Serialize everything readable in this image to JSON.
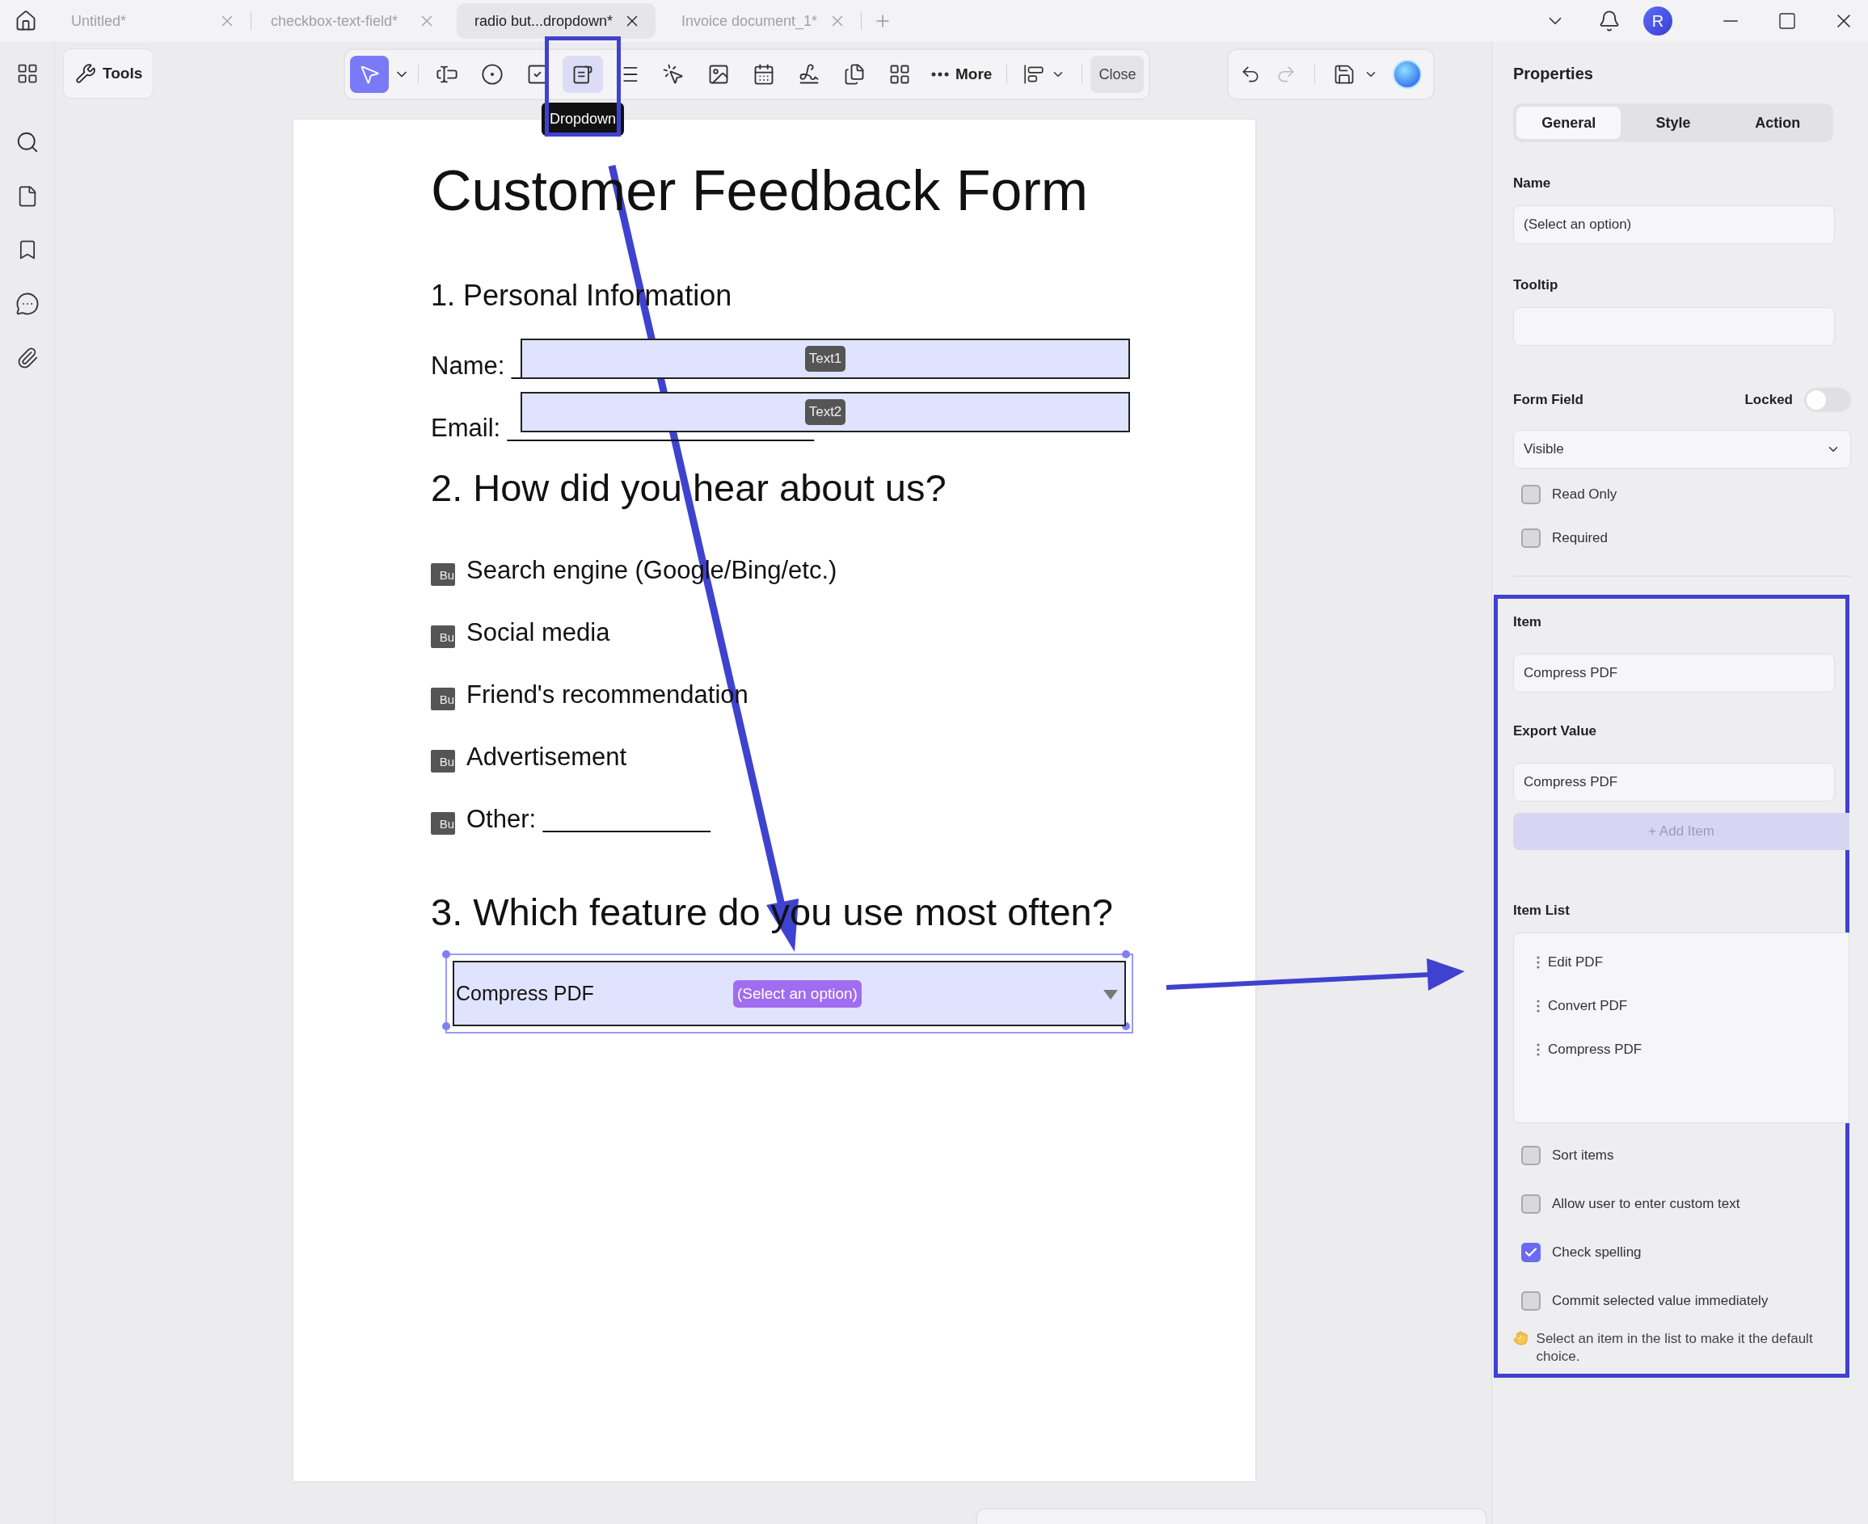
{
  "tabs": [
    {
      "label": "Untitled*",
      "selected": false
    },
    {
      "label": "checkbox-text-field*",
      "selected": false
    },
    {
      "label": "radio but...dropdown*",
      "selected": true
    },
    {
      "label": "Invoice document_1*",
      "selected": false
    }
  ],
  "avatar": {
    "initial": "R"
  },
  "toolbar": {
    "tools_button": "Tools",
    "tools": [
      {
        "kind": "select",
        "selected": true,
        "hovered": false
      },
      {
        "kind": "text-field",
        "selected": false,
        "hovered": false
      },
      {
        "kind": "radio",
        "selected": false,
        "hovered": false
      },
      {
        "kind": "checkbox",
        "selected": false,
        "hovered": false
      },
      {
        "kind": "dropdown",
        "selected": false,
        "hovered": true
      },
      {
        "kind": "list-box",
        "selected": false,
        "hovered": false
      },
      {
        "kind": "button",
        "selected": false,
        "hovered": false
      },
      {
        "kind": "image",
        "selected": false,
        "hovered": false
      },
      {
        "kind": "date",
        "selected": false,
        "hovered": false
      },
      {
        "kind": "signature",
        "selected": false,
        "hovered": false
      },
      {
        "kind": "copy",
        "selected": false,
        "hovered": false
      },
      {
        "kind": "grid",
        "selected": false,
        "hovered": false
      }
    ],
    "tooltip": "Dropdown",
    "more": "More",
    "close": "Close"
  },
  "document": {
    "title": "Customer Feedback Form",
    "section_1": {
      "heading": "1. Personal Information",
      "fields": [
        {
          "label": "Name: _",
          "tag": "Text1"
        },
        {
          "label": "Email: ______________________",
          "tag": "Text2"
        }
      ]
    },
    "section_2": {
      "heading": "2. How did you hear about us?",
      "options": [
        {
          "label": "Search engine (Google/Bing/etc.)",
          "badge": "Bu"
        },
        {
          "label": "Social media",
          "badge": "Bu"
        },
        {
          "label": "Friend's recommendation",
          "badge": "Bu"
        },
        {
          "label": "Advertisement",
          "badge": "Bu"
        },
        {
          "label": "Other: ____________",
          "badge": "Bu"
        }
      ]
    },
    "section_3": {
      "heading": "3. Which feature do you use most often?",
      "dropdown": {
        "value": "Compress PDF",
        "tag": "(Select an option)"
      }
    }
  },
  "properties": {
    "title": "Properties",
    "tabs": [
      {
        "label": "General",
        "selected": true
      },
      {
        "label": "Style",
        "selected": false
      },
      {
        "label": "Action",
        "selected": false
      }
    ],
    "name": {
      "label": "Name",
      "value": "(Select an option)"
    },
    "tooltip": {
      "label": "Tooltip"
    },
    "form_field": {
      "label": "Form Field",
      "locked_label": "Locked",
      "locked": false,
      "visibility": "Visible"
    },
    "options": [
      {
        "label": "Read Only",
        "checked": false
      },
      {
        "label": "Required",
        "checked": false
      }
    ],
    "item": {
      "label": "Item",
      "value": "Compress PDF"
    },
    "export_value": {
      "label": "Export Value",
      "value": "Compress PDF"
    },
    "add_item": {
      "label": "+ Add Item",
      "disabled": true
    },
    "item_list": {
      "label": "Item List",
      "items": [
        "Edit PDF",
        "Convert PDF",
        "Compress PDF"
      ]
    },
    "list_options": [
      {
        "label": "Sort items",
        "checked": false
      },
      {
        "label": "Allow user to enter custom text",
        "checked": false
      },
      {
        "label": "Check spelling",
        "checked": true
      },
      {
        "label": "Commit selected value immediately",
        "checked": false
      }
    ],
    "hint": "Select an item in the list to make it the default choice."
  }
}
